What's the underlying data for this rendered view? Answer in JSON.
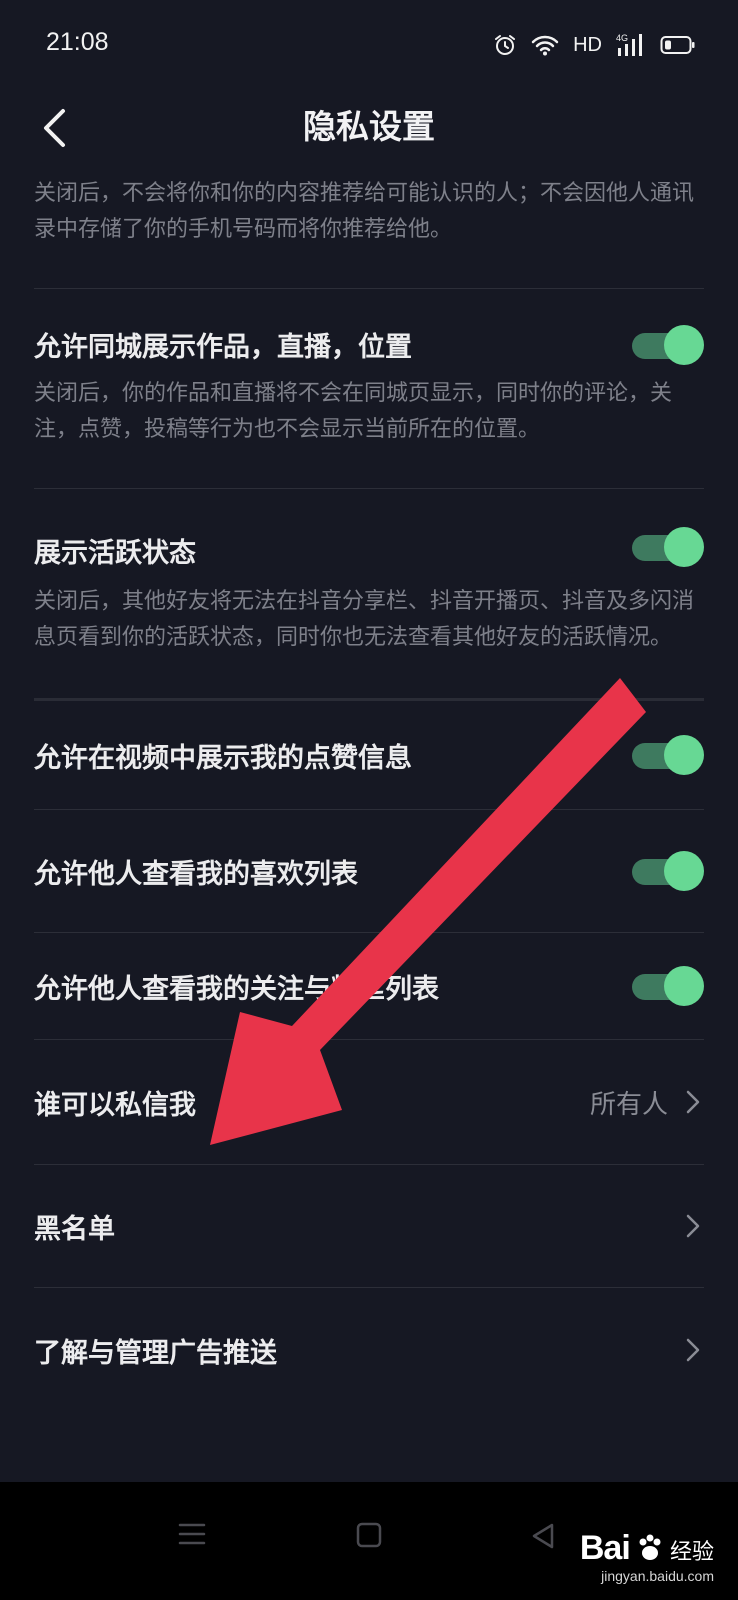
{
  "status": {
    "time": "21:08",
    "network": "HD",
    "signal_label": "4G"
  },
  "nav": {
    "title": "隐私设置"
  },
  "top_description": "关闭后，不会将你和你的内容推荐给可能认识的人；不会因他人通讯录中存储了你的手机号码而将你推荐给他。",
  "settings": [
    {
      "title": "允许同城展示作品，直播，位置",
      "description": "关闭后，你的作品和直播将不会在同城页显示，同时你的评论，关注，点赞，投稿等行为也不会显示当前所在的位置。",
      "enabled": true
    },
    {
      "title": "展示活跃状态",
      "description": "关闭后，其他好友将无法在抖音分享栏、抖音开播页、抖音及多闪消息页看到你的活跃状态，同时你也无法查看其他好友的活跃情况。",
      "enabled": true
    }
  ],
  "toggles": [
    {
      "title": "允许在视频中展示我的点赞信息",
      "enabled": true
    },
    {
      "title": "允许他人查看我的喜欢列表",
      "enabled": true
    },
    {
      "title": "允许他人查看我的关注与粉丝列表",
      "enabled": true
    }
  ],
  "links": [
    {
      "title": "谁可以私信我",
      "value": "所有人"
    },
    {
      "title": "黑名单",
      "value": ""
    },
    {
      "title": "了解与管理广告推送",
      "value": ""
    }
  ],
  "watermark": {
    "brand": "Bai",
    "brand_cn": "经验",
    "site": "jingyan.baidu.com"
  },
  "colors": {
    "background": "#161823",
    "toggle_on": "#67d894",
    "arrow": "#e8344a"
  }
}
